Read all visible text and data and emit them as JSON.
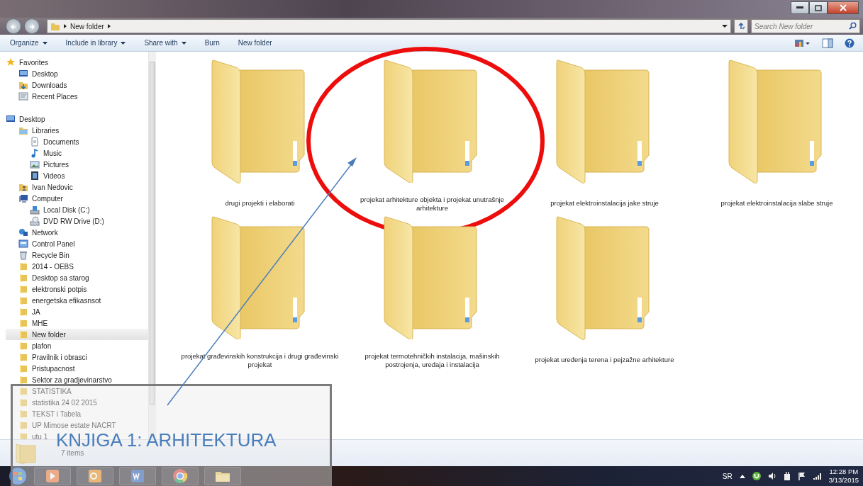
{
  "address_bar": {
    "path": "New folder"
  },
  "search": {
    "placeholder": "Search New folder"
  },
  "toolbar": [
    {
      "label": "Organize",
      "dropdown": true
    },
    {
      "label": "Include in library",
      "dropdown": true
    },
    {
      "label": "Share with",
      "dropdown": true
    },
    {
      "label": "Burn",
      "dropdown": false
    },
    {
      "label": "New folder",
      "dropdown": false
    }
  ],
  "sidebar": {
    "groups": [
      {
        "items": [
          {
            "label": "Favorites",
            "kind": "star",
            "selected": false,
            "children": [
              {
                "label": "Desktop",
                "kind": "desktop",
                "selected": false
              },
              {
                "label": "Downloads",
                "kind": "download",
                "selected": false
              },
              {
                "label": "Recent Places",
                "kind": "recent",
                "selected": false
              }
            ]
          }
        ]
      },
      {
        "items": [
          {
            "label": "Desktop",
            "kind": "desktop",
            "selected": false,
            "children": [
              {
                "label": "Libraries",
                "kind": "library",
                "selected": false,
                "children": [
                  {
                    "label": "Documents",
                    "kind": "document",
                    "selected": false
                  },
                  {
                    "label": "Music",
                    "kind": "music",
                    "selected": false
                  },
                  {
                    "label": "Pictures",
                    "kind": "picture",
                    "selected": false
                  },
                  {
                    "label": "Videos",
                    "kind": "video",
                    "selected": false
                  }
                ]
              },
              {
                "label": "Ivan Nedovic",
                "kind": "user",
                "selected": false
              },
              {
                "label": "Computer",
                "kind": "computer",
                "selected": false,
                "children": [
                  {
                    "label": "Local Disk (C:)",
                    "kind": "disk",
                    "selected": false
                  },
                  {
                    "label": "DVD RW Drive (D:)",
                    "kind": "dvd",
                    "selected": false
                  }
                ]
              },
              {
                "label": "Network",
                "kind": "network",
                "selected": false
              },
              {
                "label": "Control Panel",
                "kind": "control",
                "selected": false
              },
              {
                "label": "Recycle Bin",
                "kind": "bin",
                "selected": false
              },
              {
                "label": "2014 - OEBS",
                "kind": "folder",
                "selected": false
              },
              {
                "label": "Desktop sa starog",
                "kind": "folder",
                "selected": false
              },
              {
                "label": "elektronski potpis",
                "kind": "folder",
                "selected": false
              },
              {
                "label": "energetska efikasnsot",
                "kind": "folder",
                "selected": false
              },
              {
                "label": "JA",
                "kind": "folder",
                "selected": false
              },
              {
                "label": "MHE",
                "kind": "folder",
                "selected": false
              },
              {
                "label": "New folder",
                "kind": "folder",
                "selected": true
              },
              {
                "label": "plafon",
                "kind": "folder",
                "selected": false
              },
              {
                "label": "Pravilnik i obrasci",
                "kind": "folder",
                "selected": false
              },
              {
                "label": "Pristupacnost",
                "kind": "folder",
                "selected": false
              },
              {
                "label": "Sektor za gradjevinarstvo",
                "kind": "folder",
                "selected": false
              },
              {
                "label": "STATISTIKA",
                "kind": "folder",
                "selected": false
              },
              {
                "label": "statistika 24 02 2015",
                "kind": "folder",
                "selected": false
              },
              {
                "label": "TEKST i Tabela",
                "kind": "folder",
                "selected": false
              },
              {
                "label": "UP Mimose estate NACRT",
                "kind": "folder",
                "selected": false
              },
              {
                "label": "utu 1",
                "kind": "folder",
                "selected": false
              }
            ]
          }
        ]
      }
    ]
  },
  "folders": [
    {
      "label": "drugi projekti i elaborati",
      "circled": false
    },
    {
      "label": "projekat arhitekture objekta i projekat unutrašnje arhitekture",
      "circled": true
    },
    {
      "label": "projekat elektroinstalacija jake struje",
      "circled": false
    },
    {
      "label": "projekat elektroinstalacija slabe struje",
      "circled": false
    },
    {
      "label": "projekat građevinskih konstrukcija i drugi građevinski projekat",
      "circled": false
    },
    {
      "label": "projekat termotehničkih instalacija, mašinskih postrojenja, uređaja i instalacija",
      "circled": false
    },
    {
      "label": "projekat uređenja terena i pejzažne arhitekture",
      "circled": false
    }
  ],
  "status_bar": {
    "text": "7 items"
  },
  "taskbar": {
    "apps": [
      {
        "kind": "start"
      },
      {
        "kind": "media"
      },
      {
        "kind": "outlook"
      },
      {
        "kind": "word"
      },
      {
        "kind": "chrome"
      },
      {
        "kind": "explorer"
      }
    ],
    "language": "SR",
    "time": "12:28 PM",
    "date": "3/13/2015"
  },
  "callout": {
    "text": "KNJIGA 1: ARHITEKTURA"
  }
}
